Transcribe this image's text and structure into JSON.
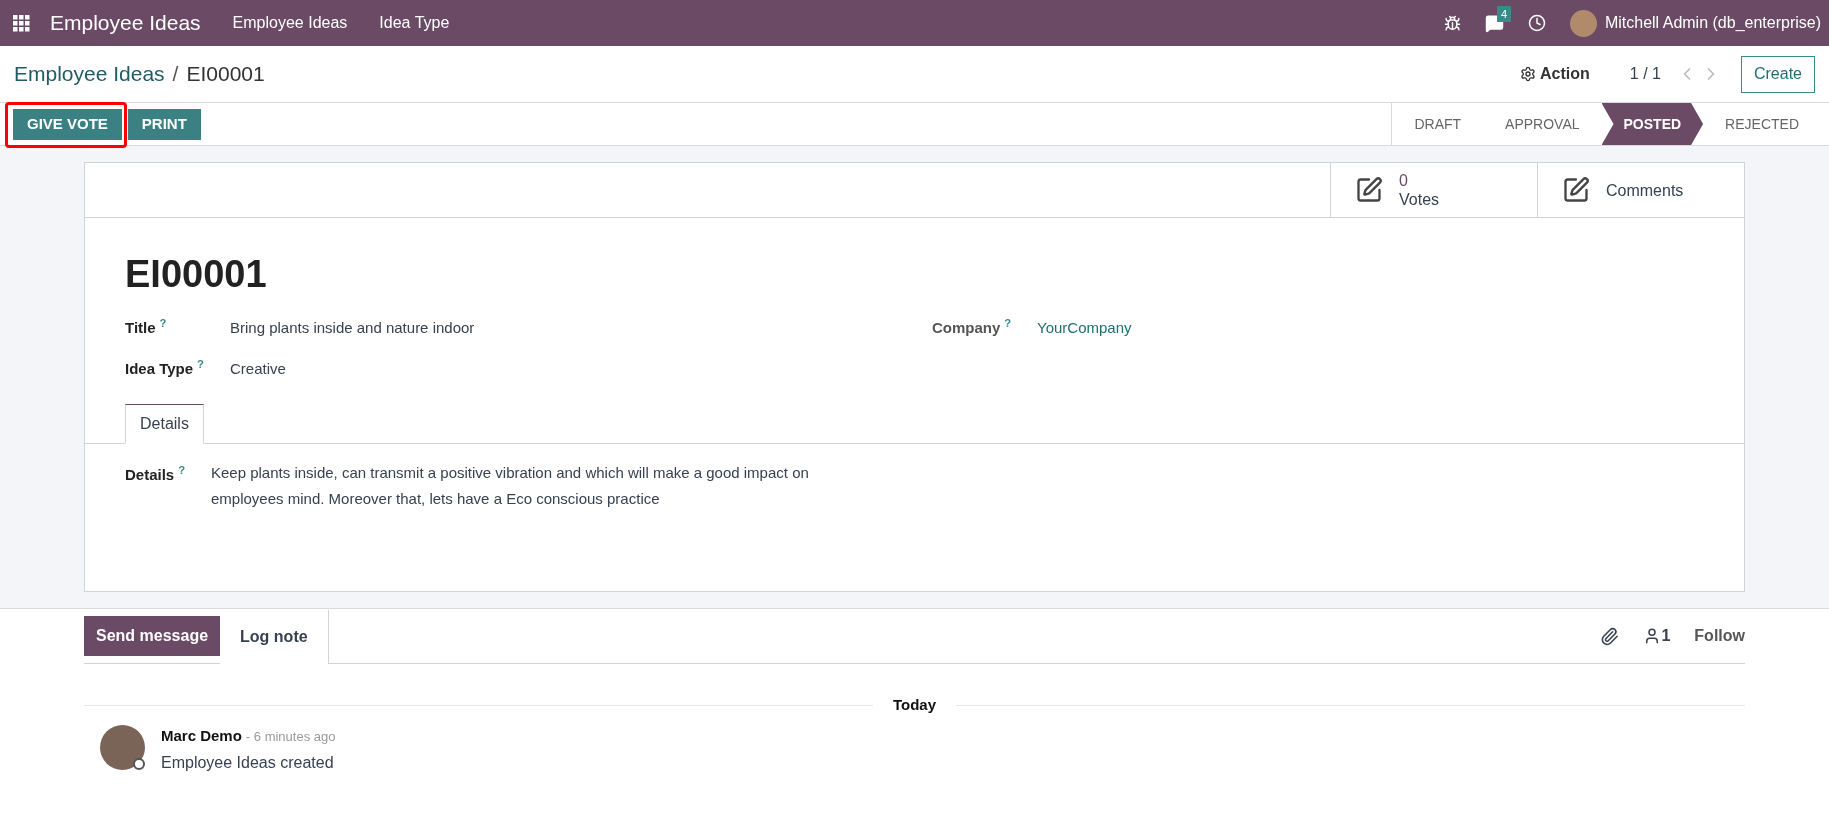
{
  "navbar": {
    "app_name": "Employee Ideas",
    "menu": [
      "Employee Ideas",
      "Idea Type"
    ],
    "message_count": "4",
    "user": "Mitchell Admin (db_enterprise)"
  },
  "breadcrumb": {
    "parent": "Employee Ideas",
    "separator": "/",
    "current": "EI00001"
  },
  "control_panel": {
    "action": "Action",
    "pager": "1 / 1",
    "create": "Create"
  },
  "buttons": [
    {
      "label": "GIVE VOTE",
      "highlighted": true
    },
    {
      "label": "PRINT",
      "highlighted": false
    }
  ],
  "stages": [
    {
      "label": "DRAFT",
      "selected": false
    },
    {
      "label": "APPROVAL",
      "selected": false
    },
    {
      "label": "POSTED",
      "selected": true
    },
    {
      "label": "REJECTED",
      "selected": false
    }
  ],
  "smart_buttons": [
    {
      "value": "0",
      "label": "Votes"
    },
    {
      "label": "Comments"
    }
  ],
  "record": {
    "name": "EI00001",
    "left_fields": [
      {
        "label": "Title",
        "help": "?",
        "value": "Bring plants inside and nature indoor"
      },
      {
        "label": "Idea Type",
        "help": "?",
        "value": "Creative"
      }
    ],
    "right_fields": [
      {
        "label": "Company",
        "help": "?",
        "value": "YourCompany"
      }
    ]
  },
  "tabs": [
    {
      "label": "Details",
      "selected": true
    }
  ],
  "details": {
    "label": "Details",
    "help": "?",
    "value": "Keep plants inside, can transmit a positive vibration and which will make a good impact on employees mind. Moreover that, lets have a Eco conscious practice"
  },
  "chatter": {
    "send_message": "Send message",
    "log_note": "Log note",
    "followers": "1",
    "follow": "Follow",
    "date_separator": "Today",
    "messages": [
      {
        "author": "Marc Demo",
        "time": "- 6 minutes ago",
        "body": "Employee Ideas created"
      }
    ]
  }
}
